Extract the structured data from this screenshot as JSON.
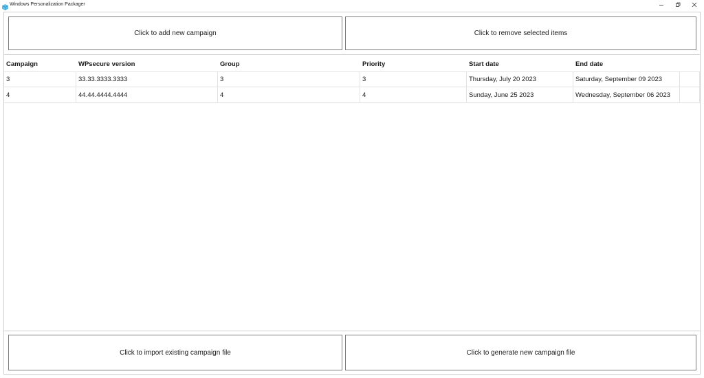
{
  "window": {
    "title": "Windows Personalization Packager",
    "icon": "package-icon",
    "controls": {
      "minimize": "minimize-icon",
      "restore": "restore-icon",
      "close": "close-icon"
    }
  },
  "toolbar": {
    "add_label": "Click to add new campaign",
    "remove_label": "Click to remove selected items"
  },
  "grid": {
    "columns": [
      "Campaign",
      "WPsecure version",
      "Group",
      "Priority",
      "Start date",
      "End date"
    ],
    "rows": [
      [
        "3",
        "33.33.3333.3333",
        "3",
        "3",
        "Thursday, July 20 2023",
        "Saturday, September 09 2023"
      ],
      [
        "4",
        "44.44.4444.4444",
        "4",
        "4",
        "Sunday, June 25 2023",
        "Wednesday, September 06 2023"
      ]
    ]
  },
  "footer": {
    "import_label": "Click to import existing campaign file",
    "generate_label": "Click to generate new campaign file"
  },
  "colors": {
    "button_border": "#7a7a7a",
    "grid_line": "#e2e2e2",
    "icon_accent": "#2b9fd9"
  }
}
